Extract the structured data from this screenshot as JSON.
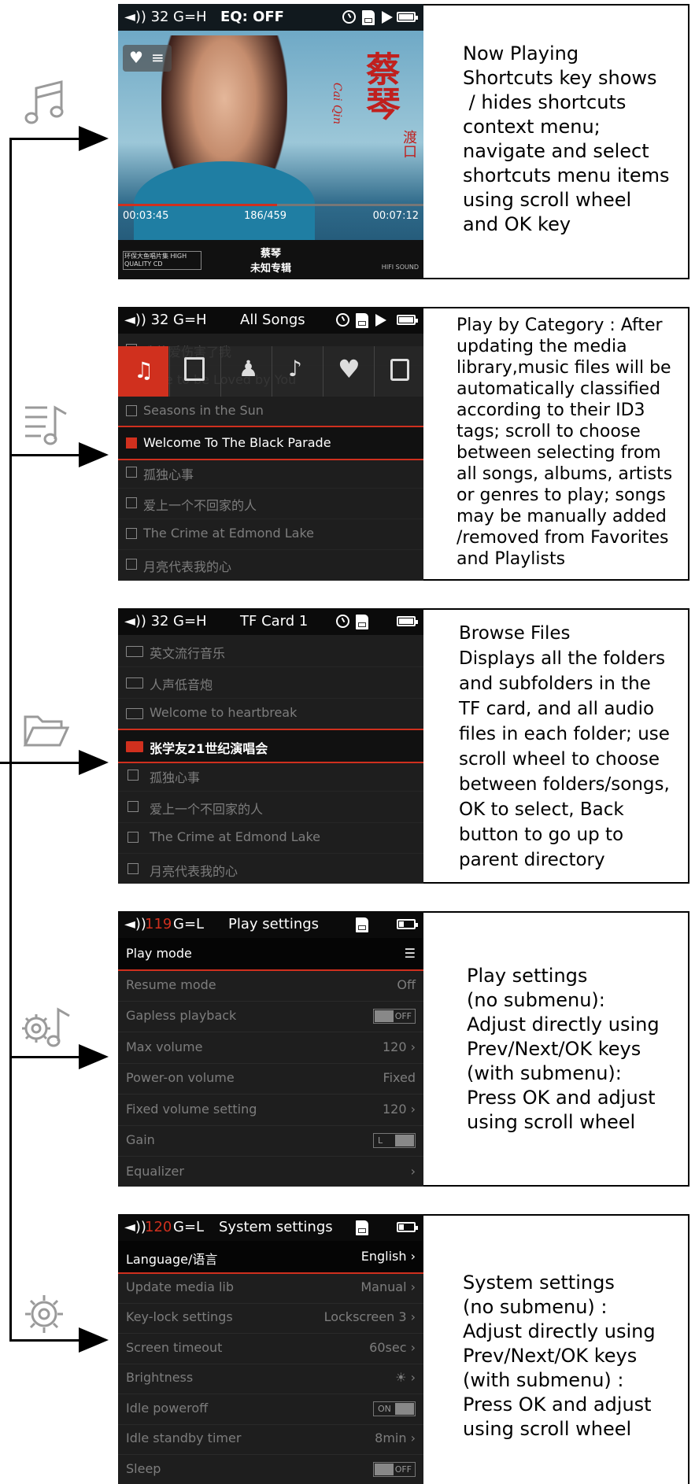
{
  "panels": [
    {
      "name": "now-playing",
      "status": {
        "volume": "◄)) 32",
        "gain": "G=H",
        "title": "EQ: OFF"
      },
      "elapsed": "00:03:45",
      "track_index": "186/459",
      "total": "00:07:12",
      "progress": 0.52,
      "artist": "蔡琴",
      "album": "未知专辑",
      "album_art_title": "蔡琴",
      "album_art_subtitle": "渡口",
      "album_art_roman": "Cai Qin",
      "label_left": "环保大鱼唱片集 HIGH QUALITY CD",
      "label_right": "HIFI SOUND",
      "description": "Now Playing\nShortcuts key shows\n / hides shortcuts\ncontext menu;\nnavigate and select\nshortcuts menu items\nusing scroll wheel\nand OK key"
    },
    {
      "name": "all-songs",
      "status": {
        "volume": "◄)) 32",
        "gain": "G=H",
        "title": "All Songs"
      },
      "items": [
        "我的爱伤害了我",
        "Love to be Loved by You",
        "Seasons in the Sun",
        "Welcome To The Black Parade",
        "孤独心事",
        "爱上一个不回家的人",
        "The Crime at Edmond Lake",
        "月亮代表我的心"
      ],
      "selected_index": 3,
      "category_icons": [
        "note-icon",
        "album-icon",
        "artist-icon",
        "guitar-icon",
        "heart-icon",
        "playlist-icon"
      ],
      "description": "Play by Category : After\nupdating the media\nlibrary,music files will be\nautomatically classified\naccording to their ID3\ntags; scroll to choose\nbetween selecting from\nall songs, albums, artists\nor genres to play; songs\nmay be manually added\n/removed from Favorites\nand Playlists"
    },
    {
      "name": "browse-files",
      "status": {
        "volume": "◄)) 32",
        "gain": "G=H",
        "title": "TF Card 1"
      },
      "items": [
        {
          "type": "folder",
          "label": "英文流行音乐"
        },
        {
          "type": "folder",
          "label": "人声低音炮"
        },
        {
          "type": "folder",
          "label": "Welcome to  heartbreak"
        },
        {
          "type": "folder",
          "label": "张学友21世纪演唱会"
        },
        {
          "type": "file",
          "label": "孤独心事"
        },
        {
          "type": "file",
          "label": "爱上一个不回家的人"
        },
        {
          "type": "file",
          "label": "The Crime at Edmond Lake"
        },
        {
          "type": "file",
          "label": "月亮代表我的心"
        }
      ],
      "selected_index": 3,
      "description": "Browse Files\nDisplays all the folders\nand subfolders in the\nTF card, and all audio\nfiles in each folder; use\nscroll wheel to choose\nbetween folders/songs,\nOK to select, Back\nbutton to go up to\nparent directory"
    },
    {
      "name": "play-settings",
      "status": {
        "volume": "◄))",
        "volume_num": "119",
        "gain": "G=L",
        "title": "Play settings"
      },
      "rows": [
        {
          "label": "Play mode",
          "value": "☰",
          "selected": true
        },
        {
          "label": "Resume mode",
          "value": "Off"
        },
        {
          "label": "Gapless playback",
          "toggle": "OFF"
        },
        {
          "label": "Max volume",
          "value": "120 ›"
        },
        {
          "label": "Power-on volume",
          "value": "Fixed"
        },
        {
          "label": "Fixed volume setting",
          "value": "120 ›"
        },
        {
          "label": "Gain",
          "toggle": "L"
        },
        {
          "label": "Equalizer",
          "value": "›"
        }
      ],
      "description": "Play settings\n(no submenu):\nAdjust directly using\nPrev/Next/OK keys\n(with submenu):\nPress OK and adjust\nusing scroll wheel"
    },
    {
      "name": "system-settings",
      "status": {
        "volume": "◄))",
        "volume_num": "120",
        "gain": "G=L",
        "title": "System settings"
      },
      "rows": [
        {
          "label": "Language/语言",
          "value": "English ›",
          "selected": true
        },
        {
          "label": "Update media lib",
          "value": "Manual ›"
        },
        {
          "label": "Key-lock settings",
          "value": "Lockscreen 3 ›"
        },
        {
          "label": "Screen timeout",
          "value": "60sec ›"
        },
        {
          "label": "Brightness",
          "value": "☀ ›"
        },
        {
          "label": "Idle poweroff",
          "toggle": "ON"
        },
        {
          "label": "Idle standby timer",
          "value": "8min ›"
        },
        {
          "label": "Sleep",
          "toggle": "OFF"
        }
      ],
      "description": "System settings\n(no submenu) :\nAdjust directly using\nPrev/Next/OK keys\n(with submenu) :\nPress OK and adjust\nusing scroll wheel"
    }
  ],
  "side_icons": [
    "music-note-icon",
    "song-list-icon",
    "folder-icon",
    "play-settings-icon",
    "system-settings-icon"
  ]
}
